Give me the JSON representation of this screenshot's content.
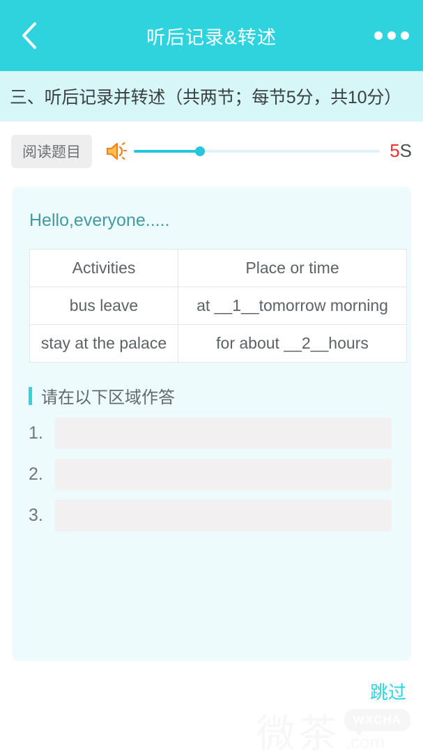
{
  "header": {
    "title": "听后记录&转述",
    "back_icon": "chevron-left-icon",
    "more_icon": "more-dots-icon"
  },
  "subtitle": {
    "text": "三、听后记录并转述（共两节；每节5分，共10分）"
  },
  "controls": {
    "read_button_label": "阅读题目",
    "speaker_icon": "speaker-icon",
    "progress_percent": 27,
    "timer_value": "5",
    "timer_unit": "S"
  },
  "card": {
    "greeting": "Hello,everyone.....",
    "table": {
      "headers": [
        "Activities",
        "Place or time"
      ],
      "rows": [
        [
          "bus leave",
          "at __1__tomorrow morning"
        ],
        [
          "stay at the palace",
          "for about __2__hours"
        ]
      ]
    },
    "answer_section": {
      "heading": "请在以下区域作答",
      "items": [
        {
          "index": "1.",
          "value": "",
          "placeholder": ""
        },
        {
          "index": "2.",
          "value": "",
          "placeholder": ""
        },
        {
          "index": "3.",
          "value": "",
          "placeholder": ""
        }
      ]
    }
  },
  "footer": {
    "skip_label": "跳过",
    "watermark_cn": "微茶",
    "watermark_brand": "WXCHA",
    "watermark_domain": ".com"
  },
  "colors": {
    "brand_teal": "#2ed3dd",
    "subtitle_bg": "#d7f6f8",
    "card_bg": "#edfbfc",
    "greeting_text": "#3f9ba1",
    "timer_red": "#f03030",
    "speaker_orange": "#f58220"
  }
}
